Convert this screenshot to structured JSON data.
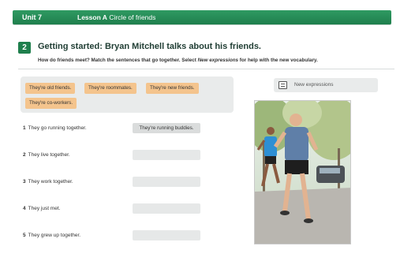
{
  "header": {
    "unit": "Unit 7",
    "lesson_prefix": "Lesson A",
    "lesson_title": "Circle of friends"
  },
  "activity": {
    "number": "2",
    "title": "Getting started: Bryan Mitchell talks about his friends.",
    "instructions_part1": "How do friends meet? Match the sentences that go together. Select ",
    "instructions_em": "New expressions",
    "instructions_part2": " for help with the new vocabulary."
  },
  "answer_bank": [
    "They're old friends.",
    "They're roommates.",
    "They're new friends.",
    "They're co-workers."
  ],
  "new_expressions": {
    "label": "New expressions",
    "icon": "book-icon"
  },
  "sentences": [
    {
      "number": "1",
      "text": "They go running together.",
      "answer": "They're running buddies."
    },
    {
      "number": "2",
      "text": "They live together.",
      "answer": ""
    },
    {
      "number": "3",
      "text": "They work together.",
      "answer": ""
    },
    {
      "number": "4",
      "text": "They just met.",
      "answer": ""
    },
    {
      "number": "5",
      "text": "They grew up together.",
      "answer": ""
    }
  ],
  "colors": {
    "header_green": "#1f7f4d",
    "chip_orange": "#f4c48d",
    "panel_gray": "#e9ebeb"
  }
}
